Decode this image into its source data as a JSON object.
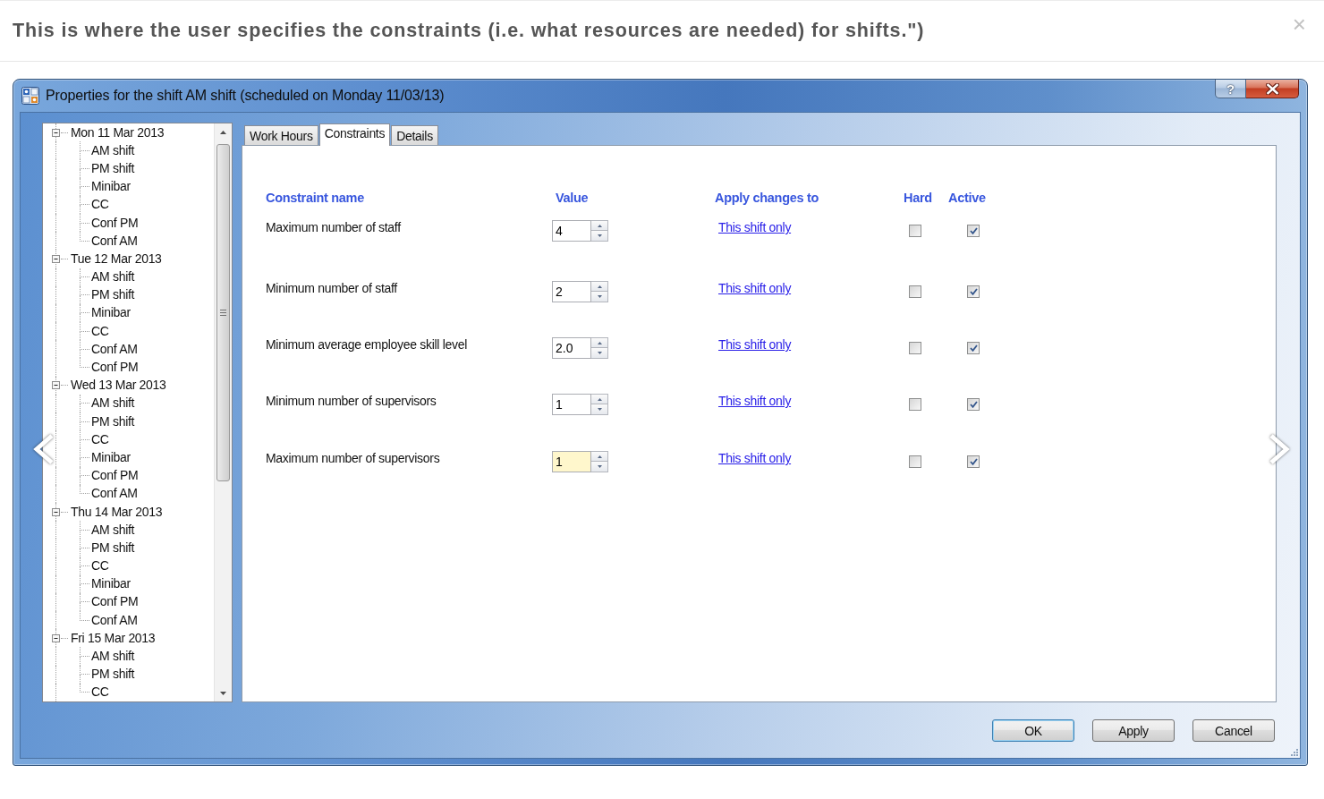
{
  "caption": {
    "text": "This is where the user specifies the constraints (i.e. what resources are needed) for shifts.\")",
    "close": "×"
  },
  "dialog": {
    "title": "Properties for the shift AM shift (scheduled on Monday 11/03/13)",
    "help_button": "?",
    "tree": [
      {
        "label": "Mon 11 Mar 2013",
        "expanded": true,
        "children": [
          {
            "label": "AM shift"
          },
          {
            "label": "PM shift"
          },
          {
            "label": "Minibar"
          },
          {
            "label": "CC"
          },
          {
            "label": "Conf PM"
          },
          {
            "label": "Conf AM"
          }
        ]
      },
      {
        "label": "Tue 12 Mar 2013",
        "expanded": true,
        "children": [
          {
            "label": "AM shift"
          },
          {
            "label": "PM shift"
          },
          {
            "label": "Minibar"
          },
          {
            "label": "CC"
          },
          {
            "label": "Conf AM"
          },
          {
            "label": "Conf PM"
          }
        ]
      },
      {
        "label": "Wed 13 Mar 2013",
        "expanded": true,
        "children": [
          {
            "label": "AM shift"
          },
          {
            "label": "PM shift"
          },
          {
            "label": "CC"
          },
          {
            "label": "Minibar"
          },
          {
            "label": "Conf PM"
          },
          {
            "label": "Conf AM"
          }
        ]
      },
      {
        "label": "Thu 14 Mar 2013",
        "expanded": true,
        "children": [
          {
            "label": "AM shift"
          },
          {
            "label": "PM shift"
          },
          {
            "label": "CC"
          },
          {
            "label": "Minibar"
          },
          {
            "label": "Conf PM"
          },
          {
            "label": "Conf AM"
          }
        ]
      },
      {
        "label": "Fri 15 Mar 2013",
        "expanded": true,
        "children": [
          {
            "label": "AM shift"
          },
          {
            "label": "PM shift"
          },
          {
            "label": "CC"
          }
        ]
      }
    ],
    "tabs": [
      {
        "label": "Work Hours",
        "selected": false
      },
      {
        "label": "Constraints",
        "selected": true
      },
      {
        "label": "Details",
        "selected": false
      }
    ],
    "constraints": {
      "columns": [
        "Constraint name",
        "Value",
        "Apply changes to",
        "Hard",
        "Active"
      ],
      "rows": [
        {
          "name": "Maximum number of staff",
          "value": "4",
          "apply_to": "This shift only",
          "hard": false,
          "active": true,
          "focused": false
        },
        {
          "name": "Minimum number of staff",
          "value": "2",
          "apply_to": "This shift only",
          "hard": false,
          "active": true,
          "focused": false
        },
        {
          "name": "Minimum average employee skill level",
          "value": "2.0",
          "apply_to": "This shift only",
          "hard": false,
          "active": true,
          "focused": false
        },
        {
          "name": "Minimum number of supervisors",
          "value": "1",
          "apply_to": "This shift only",
          "hard": false,
          "active": true,
          "focused": false
        },
        {
          "name": "Maximum number of supervisors",
          "value": "1",
          "apply_to": "This shift only",
          "hard": false,
          "active": true,
          "focused": true
        }
      ]
    },
    "buttons": [
      {
        "label": "OK",
        "default": true
      },
      {
        "label": "Apply",
        "default": false
      },
      {
        "label": "Cancel",
        "default": false
      }
    ]
  }
}
